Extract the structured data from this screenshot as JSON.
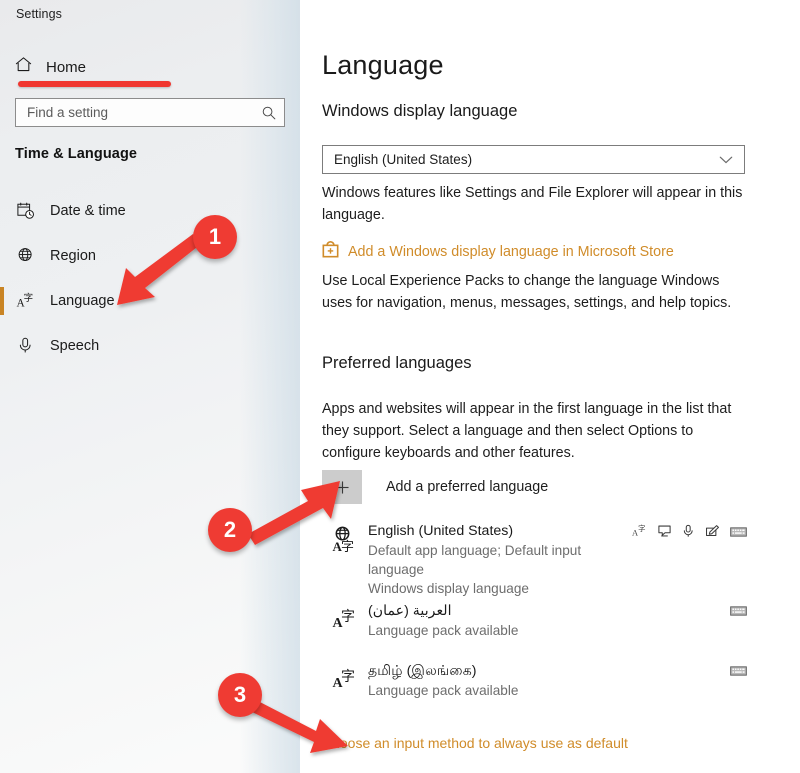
{
  "app": {
    "title": "Settings"
  },
  "sidebar": {
    "home_label": "Home",
    "home_icon": "home-icon",
    "search": {
      "placeholder": "Find a setting",
      "value": "",
      "icon": "search-icon"
    },
    "section_title": "Time & Language",
    "items": [
      {
        "label": "Date & time",
        "icon": "calendar-clock-icon",
        "selected": false
      },
      {
        "label": "Region",
        "icon": "globe-icon",
        "selected": false
      },
      {
        "label": "Language",
        "icon": "language-character-icon",
        "selected": true
      },
      {
        "label": "Speech",
        "icon": "microphone-icon",
        "selected": false
      }
    ],
    "accent_color": "#c98424"
  },
  "main": {
    "page_title": "Language",
    "display_language": {
      "heading": "Windows display language",
      "selected": "English (United States)",
      "chevron_icon": "chevron-down-icon",
      "description": "Windows features like Settings and File Explorer will appear in this language.",
      "store_link": "Add a Windows display language in Microsoft Store",
      "store_icon": "microsoft-store-icon",
      "store_link_color": "#d08c2a",
      "lep_description": "Use Local Experience Packs to change the language Windows uses for navigation, menus, messages, settings, and help topics."
    },
    "preferred_languages": {
      "heading": "Preferred languages",
      "description": "Apps and websites will appear in the first language in the list that they support. Select a language and then select Options to configure keyboards and other features.",
      "add_button_label": "Add a preferred language",
      "add_button_icon": "plus-icon",
      "items": [
        {
          "name": "English (United States)",
          "sub1": "Default app language; Default input language",
          "sub2": "Windows display language",
          "icon": "globe-language-icon",
          "capabilities": [
            "language-pack-icon",
            "speech-icon",
            "microphone-icon",
            "handwriting-icon",
            "keyboard-icon"
          ]
        },
        {
          "name": "العربية (عمان)",
          "sub1": "Language pack available",
          "sub2": "",
          "icon": "language-character-icon",
          "capabilities": [
            "keyboard-icon"
          ]
        },
        {
          "name": "தமிழ் (இலங்கை)",
          "sub1": "Language pack available",
          "sub2": "",
          "icon": "language-character-icon",
          "capabilities": [
            "keyboard-icon"
          ]
        }
      ],
      "default_input_link": "Choose an input method to always use as default",
      "default_input_link_color": "#d08c2a"
    }
  },
  "annotations": {
    "color": "#ef3b33",
    "badges": [
      {
        "number": "1",
        "target": "sidebar-item-language"
      },
      {
        "number": "2",
        "target": "add-preferred-language-button"
      },
      {
        "number": "3",
        "target": "choose-default-input-method-link"
      }
    ]
  }
}
